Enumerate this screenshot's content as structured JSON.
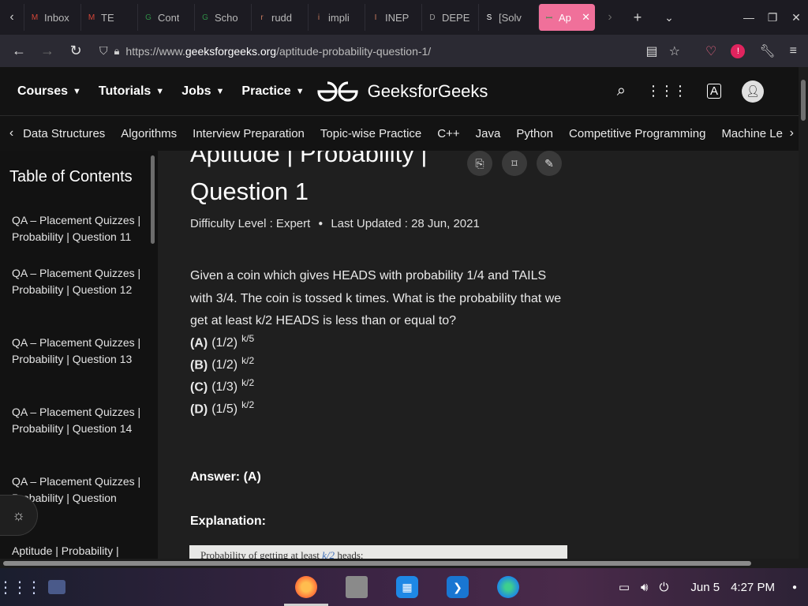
{
  "browser": {
    "tabs": [
      {
        "label": "Inbox",
        "fav_color": "#d44638",
        "fav": "M"
      },
      {
        "label": "TE",
        "fav_color": "#d44638",
        "fav": "M"
      },
      {
        "label": "Cont",
        "fav_color": "#2f8d46",
        "fav": "G"
      },
      {
        "label": "Scho",
        "fav_color": "#2f8d46",
        "fav": "G"
      },
      {
        "label": "rudd",
        "fav_color": "#c97b5e",
        "fav": "r"
      },
      {
        "label": "impli",
        "fav_color": "#c97b5e",
        "fav": "i"
      },
      {
        "label": "INEP",
        "fav_color": "#c97b5e",
        "fav": "I"
      },
      {
        "label": "DEPE",
        "fav_color": "#9a9a9a",
        "fav": "D"
      },
      {
        "label": "[Solv",
        "fav_color": "#ffffff",
        "fav": "S"
      }
    ],
    "active_tab": {
      "label": "Ap",
      "fav": "G"
    },
    "url": {
      "scheme": "https://www.",
      "host": "geeksforgeeks.org",
      "path": "/aptitude-probability-question-1/"
    }
  },
  "header": {
    "menus": [
      {
        "label": "Courses"
      },
      {
        "label": "Tutorials"
      },
      {
        "label": "Jobs"
      },
      {
        "label": "Practice"
      }
    ],
    "logo_text": "GeeksforGeeks"
  },
  "subnav": {
    "items": [
      "Data Structures",
      "Algorithms",
      "Interview Preparation",
      "Topic-wise Practice",
      "C++",
      "Java",
      "Python",
      "Competitive Programming",
      "Machine Le"
    ]
  },
  "sidebar": {
    "title": "Table of Contents",
    "items": [
      {
        "label": "QA – Placement Quizzes | Probability | Question 11"
      },
      {
        "label": "QA – Placement Quizzes | Probability | Question 12"
      },
      {
        "label": "QA – Placement Quizzes | Probability | Question 13"
      },
      {
        "label": "QA – Placement Quizzes | Probability | Question 14"
      },
      {
        "label": "QA – Placement Quizzes | Probability | Question"
      },
      {
        "label": "Aptitude | Probability |"
      }
    ]
  },
  "article": {
    "title_line1": "Aptitude | Probability |",
    "title_line2": "Question 1",
    "difficulty": "Difficulty Level : Expert",
    "last_updated": "Last Updated : 28 Jun, 2021",
    "question": "Given a coin which gives HEADS with probability 1/4 and TAILS with 3/4. The coin is tossed k times. What is the probability that we get at least k/2 HEADS is less than or equal to?",
    "options": [
      {
        "key": "(A)",
        "base": "(1/2)",
        "exp": "k/5"
      },
      {
        "key": "(B)",
        "base": "(1/2)",
        "exp": "k/2"
      },
      {
        "key": "(C)",
        "base": "(1/3)",
        "exp": "k/2"
      },
      {
        "key": "(D)",
        "base": "(1/5)",
        "exp": "k/2"
      }
    ],
    "answer": "Answer: (A)",
    "explanation_label": "Explanation:",
    "explanation_snippet": {
      "pre": "Probability of getting at least",
      "mid": "k/2",
      "post": "heads:"
    }
  },
  "taskbar": {
    "date": "Jun 5",
    "time": "4:27 PM"
  }
}
